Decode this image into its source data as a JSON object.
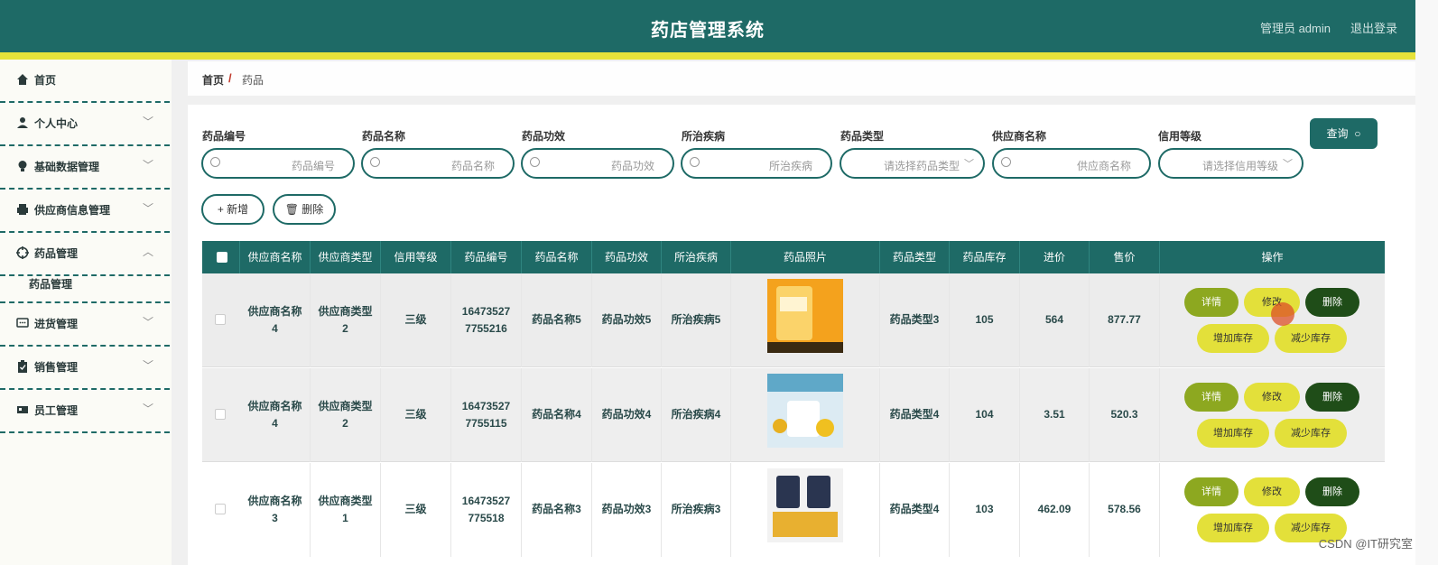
{
  "header": {
    "title": "药店管理系统",
    "user": "管理员 admin",
    "logout": "退出登录"
  },
  "sidebar": {
    "items": [
      {
        "label": "首页",
        "icon": "home-icon",
        "chev": ""
      },
      {
        "label": "个人中心",
        "icon": "user-icon",
        "chev": "﹀"
      },
      {
        "label": "基础数据管理",
        "icon": "bulb-icon",
        "chev": "﹀"
      },
      {
        "label": "供应商信息管理",
        "icon": "printer-icon",
        "chev": "﹀"
      },
      {
        "label": "药品管理",
        "icon": "target-icon",
        "chev": "︿"
      },
      {
        "label": "药品管理",
        "sub": true
      },
      {
        "label": "进货管理",
        "icon": "chat-icon",
        "chev": "﹀"
      },
      {
        "label": "销售管理",
        "icon": "clipboard-icon",
        "chev": "﹀"
      },
      {
        "label": "员工管理",
        "icon": "card-icon",
        "chev": "﹀"
      }
    ]
  },
  "breadcrumb": {
    "home": "首页",
    "sep": "/",
    "current": "药品"
  },
  "filters": [
    {
      "label": "药品编号",
      "placeholder": "药品编号",
      "type": "input"
    },
    {
      "label": "药品名称",
      "placeholder": "药品名称",
      "type": "input"
    },
    {
      "label": "药品功效",
      "placeholder": "药品功效",
      "type": "input"
    },
    {
      "label": "所治疾病",
      "placeholder": "所治疾病",
      "type": "input"
    },
    {
      "label": "药品类型",
      "placeholder": "请选择药品类型",
      "type": "select"
    },
    {
      "label": "供应商名称",
      "placeholder": "供应商名称",
      "type": "input"
    },
    {
      "label": "信用等级",
      "placeholder": "请选择信用等级",
      "type": "select"
    }
  ],
  "buttons": {
    "query": "查询",
    "add": "+ 新增",
    "delete": "删除"
  },
  "table": {
    "columns": [
      "供应商名称",
      "供应商类型",
      "信用等级",
      "药品编号",
      "药品名称",
      "药品功效",
      "所治疾病",
      "药品照片",
      "药品类型",
      "药品库存",
      "进价",
      "售价",
      "操作"
    ],
    "rows": [
      {
        "supplier_line1": "供应商名称",
        "supplier_line2": "4",
        "stype_line1": "供应商类型",
        "stype_line2": "2",
        "credit": "三级",
        "code_line1": "16473527",
        "code_line2": "7755216",
        "name": "药品名称5",
        "effect": "药品功效5",
        "disease": "所治疾病5",
        "type": "药品类型3",
        "stock": "105",
        "cost": "564",
        "price": "877.77"
      },
      {
        "supplier_line1": "供应商名称",
        "supplier_line2": "4",
        "stype_line1": "供应商类型",
        "stype_line2": "2",
        "credit": "三级",
        "code_line1": "16473527",
        "code_line2": "7755115",
        "name": "药品名称4",
        "effect": "药品功效4",
        "disease": "所治疾病4",
        "type": "药品类型4",
        "stock": "104",
        "cost": "3.51",
        "price": "520.3"
      },
      {
        "supplier_line1": "供应商名称",
        "supplier_line2": "3",
        "stype_line1": "供应商类型",
        "stype_line2": "1",
        "credit": "三级",
        "code_line1": "16473527",
        "code_line2": "775518",
        "name": "药品名称3",
        "effect": "药品功效3",
        "disease": "所治疾病3",
        "type": "药品类型4",
        "stock": "103",
        "cost": "462.09",
        "price": "578.56"
      }
    ],
    "actions": {
      "detail": "详情",
      "edit": "修改",
      "del": "删除",
      "add_stock": "增加库存",
      "sub_stock": "减少库存"
    }
  },
  "watermark": "CSDN @IT研究室",
  "colors": {
    "primary": "#1e6a66",
    "accent": "#e6e23a",
    "detail": "#8da820",
    "danger": "#1f4d18"
  }
}
